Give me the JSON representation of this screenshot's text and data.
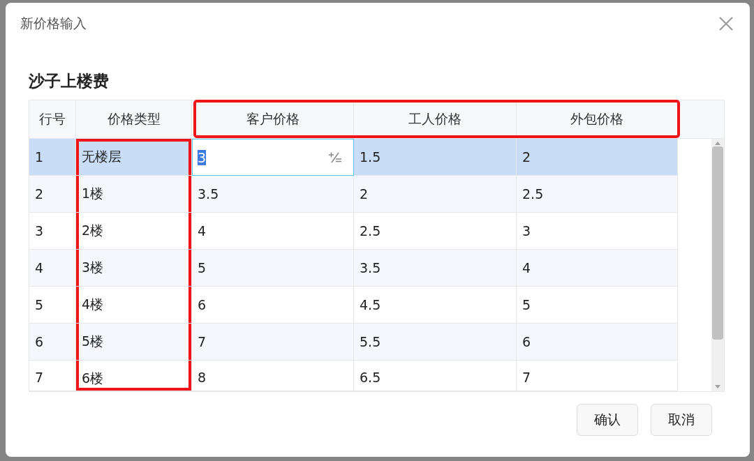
{
  "dialog": {
    "title": "新价格输入"
  },
  "section_title": "沙子上楼费",
  "table": {
    "columns": [
      {
        "label": "行号",
        "header_highlighted": false,
        "cells_highlighted": false
      },
      {
        "label": "价格类型",
        "header_highlighted": false,
        "cells_highlighted": true
      },
      {
        "label": "客户价格",
        "header_highlighted": true,
        "cells_highlighted": false
      },
      {
        "label": "工人价格",
        "header_highlighted": true,
        "cells_highlighted": false
      },
      {
        "label": "外包价格",
        "header_highlighted": true,
        "cells_highlighted": false
      }
    ],
    "rows": [
      {
        "selected": true,
        "cells": [
          {
            "text": "1",
            "editing": false
          },
          {
            "text": "无楼层",
            "editing": false
          },
          {
            "text": "3",
            "editing": true
          },
          {
            "text": "1.5",
            "editing": false
          },
          {
            "text": "2",
            "editing": false
          }
        ]
      },
      {
        "selected": false,
        "cells": [
          {
            "text": "2",
            "editing": false
          },
          {
            "text": "1楼",
            "editing": false
          },
          {
            "text": "3.5",
            "editing": false
          },
          {
            "text": "2",
            "editing": false
          },
          {
            "text": "2.5",
            "editing": false
          }
        ]
      },
      {
        "selected": false,
        "cells": [
          {
            "text": "3",
            "editing": false
          },
          {
            "text": "2楼",
            "editing": false
          },
          {
            "text": "4",
            "editing": false
          },
          {
            "text": "2.5",
            "editing": false
          },
          {
            "text": "3",
            "editing": false
          }
        ]
      },
      {
        "selected": false,
        "cells": [
          {
            "text": "4",
            "editing": false
          },
          {
            "text": "3楼",
            "editing": false
          },
          {
            "text": "5",
            "editing": false
          },
          {
            "text": "3.5",
            "editing": false
          },
          {
            "text": "4",
            "editing": false
          }
        ]
      },
      {
        "selected": false,
        "cells": [
          {
            "text": "5",
            "editing": false
          },
          {
            "text": "4楼",
            "editing": false
          },
          {
            "text": "6",
            "editing": false
          },
          {
            "text": "4.5",
            "editing": false
          },
          {
            "text": "5",
            "editing": false
          }
        ]
      },
      {
        "selected": false,
        "cells": [
          {
            "text": "6",
            "editing": false
          },
          {
            "text": "5楼",
            "editing": false
          },
          {
            "text": "7",
            "editing": false
          },
          {
            "text": "5.5",
            "editing": false
          },
          {
            "text": "6",
            "editing": false
          }
        ]
      },
      {
        "selected": false,
        "cells": [
          {
            "text": "7",
            "editing": false
          },
          {
            "text": "6楼",
            "editing": false
          },
          {
            "text": "8",
            "editing": false
          },
          {
            "text": "6.5",
            "editing": false
          },
          {
            "text": "7",
            "editing": false
          }
        ]
      }
    ]
  },
  "buttons": [
    "确认",
    "取消"
  ]
}
